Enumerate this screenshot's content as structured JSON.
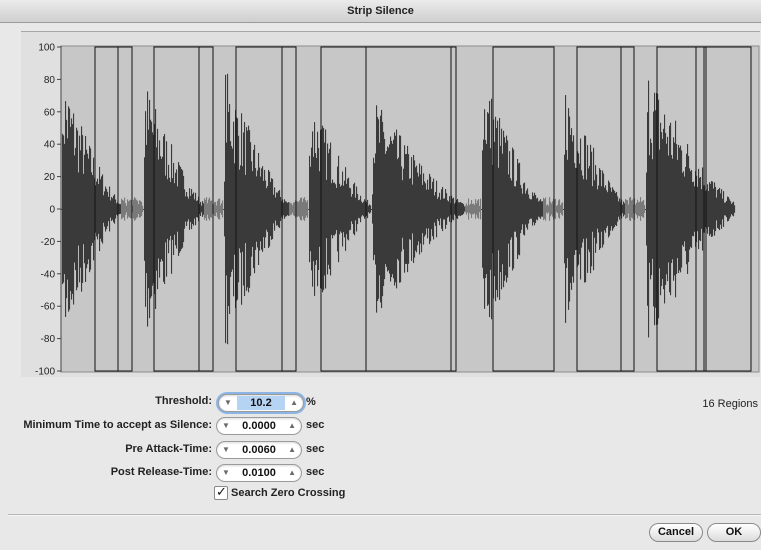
{
  "window": {
    "title": "Strip Silence"
  },
  "waveform": {
    "y_axis_ticks": [
      "100",
      "80",
      "60",
      "40",
      "20",
      "0",
      "-20",
      "-40",
      "-60",
      "-80",
      "-100"
    ],
    "region_count": 16
  },
  "form": {
    "threshold": {
      "label": "Threshold:",
      "value": "10.2",
      "unit": "%"
    },
    "min_time": {
      "label": "Minimum Time to accept as Silence:",
      "value": "0.0000",
      "unit": "sec"
    },
    "pre_attack": {
      "label": "Pre Attack-Time:",
      "value": "0.0060",
      "unit": "sec"
    },
    "post_release": {
      "label": "Post Release-Time:",
      "value": "0.0100",
      "unit": "sec"
    },
    "zero_crossing": {
      "label": "Search Zero Crossing",
      "checked": true
    }
  },
  "regions_label": "16 Regions",
  "buttons": {
    "cancel": "Cancel",
    "ok": "OK"
  },
  "colors": {
    "accent": "#8cb5e6",
    "selection": "#b5d3f3",
    "waveform": "#333333"
  }
}
